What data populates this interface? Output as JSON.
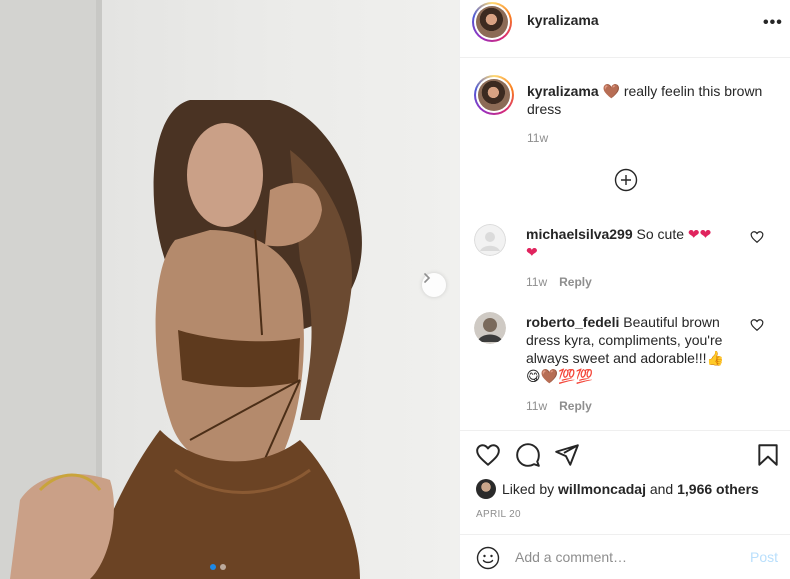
{
  "post": {
    "username": "kyralizama",
    "more_label": "•••",
    "carousel": {
      "total_images": 2,
      "current_index": 0
    }
  },
  "caption": {
    "username": "kyralizama",
    "emoji": "🤎",
    "text": " really feelin this brown dress",
    "time": "11w"
  },
  "comments": [
    {
      "username": "michaelsilva299",
      "text": " So cute ",
      "emoji_line1": "❤❤",
      "emoji_line2": "❤",
      "time": "11w",
      "reply_label": "Reply"
    },
    {
      "username": "roberto_fedeli",
      "text": " Beautiful brown dress kyra, compliments, you're always sweet and adorable!!!👍",
      "emoji_line": "😋🤎💯💯",
      "time": "11w",
      "reply_label": "Reply"
    }
  ],
  "likes": {
    "prefix": "Liked by ",
    "user": "willmoncadaj",
    "middle": " and ",
    "count": "1,966 others"
  },
  "date": "APRIL 20",
  "add_comment": {
    "placeholder": "Add a comment…",
    "post_label": "Post"
  },
  "icons": {
    "more": "more-options-icon",
    "next": "chevron-right-icon",
    "load_more": "plus-circle-icon",
    "like": "heart-icon",
    "comment": "comment-bubble-icon",
    "share": "paper-plane-icon",
    "save": "bookmark-icon",
    "emoji": "smiley-icon"
  },
  "colors": {
    "text": "#262626",
    "secondary": "#8e8e8e",
    "border": "#efefef",
    "post_disabled": "#b9dffc",
    "carousel_active": "#1e88e5"
  }
}
